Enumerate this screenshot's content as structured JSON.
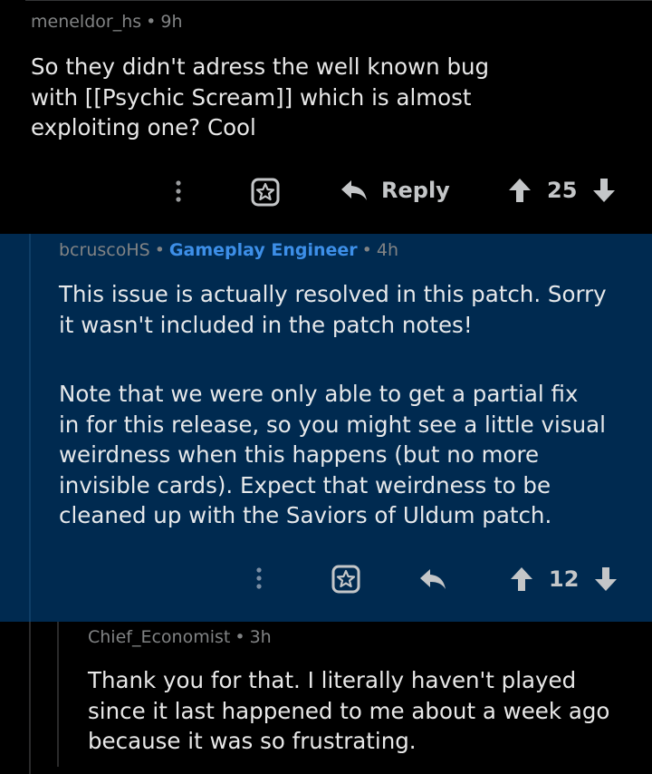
{
  "comments": [
    {
      "author": "meneldor_hs",
      "separator": "•",
      "age": "9h",
      "lines": [
        "So they didn't adress the well known bug",
        "with [[Psychic Scream]] which is almost",
        "exploiting one? Cool"
      ],
      "actions": {
        "reply_label": "Reply",
        "score": "25"
      }
    },
    {
      "author": "bcruscoHS",
      "separator": "•",
      "flair": "Gameplay Engineer",
      "age": "4h",
      "paragraph1": [
        "This issue is actually resolved in this patch. Sorry",
        "it wasn't included in the patch notes!"
      ],
      "paragraph2": [
        "Note that we were only able to get a partial fix",
        "in for this release, so you might see a little visual",
        "weirdness when this happens (but no more",
        "invisible cards). Expect that weirdness to be",
        "cleaned up with the Saviors of Uldum patch."
      ],
      "actions": {
        "score": "12"
      }
    },
    {
      "author": "Chief_Economist",
      "separator": "•",
      "age": "3h",
      "lines": [
        "Thank you for that.  I literally haven't played",
        "since it last happened to me about a week ago",
        "because it was so frustrating."
      ]
    }
  ],
  "icons": {
    "more": "more-vertical-icon",
    "award": "award-icon",
    "reply": "reply-arrow-icon",
    "upvote": "upvote-arrow-icon",
    "downvote": "downvote-arrow-icon"
  },
  "colors": {
    "background": "#000000",
    "highlight_background": "#002a50",
    "flair": "#3d8fe8",
    "meta_text": "#818384",
    "body_text": "#e8e8e8"
  }
}
